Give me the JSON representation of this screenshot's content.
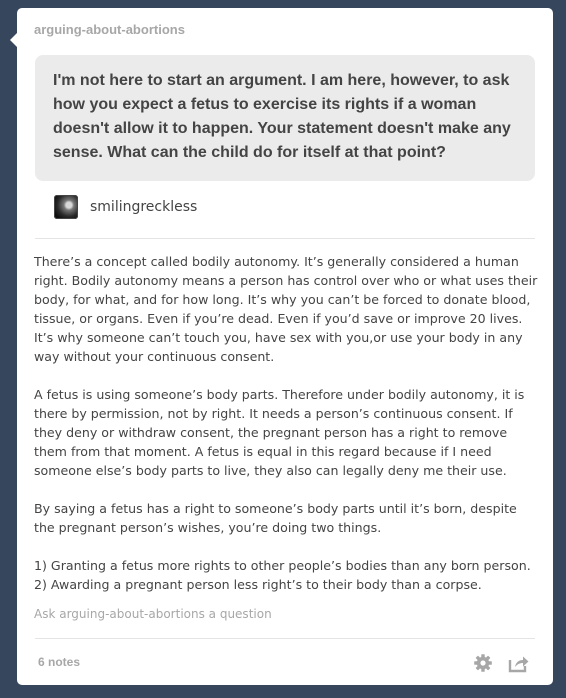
{
  "post": {
    "blog_name": "arguing-about-abortions",
    "question": "I'm not here to start an argument. I am here, however, to ask how you expect a fetus to exercise its rights if a woman doesn't allow it to happen. Your statement doesn't make any sense. What can the child do for itself at that point?",
    "asker": {
      "name": "smilingreckless",
      "avatar_icon": "avatar-image"
    },
    "answer": {
      "paragraphs": [
        "There’s a concept called bodily autonomy. It’s generally considered a human right. Bodily autonomy means a person has control over who or what uses their body, for what, and for how long. It’s why you can’t be forced to donate blood, tissue, or organs. Even if you’re dead. Even if you’d save or improve 20 lives. It’s why someone can’t touch you, have sex with you,or use your body in any way without your continuous consent.",
        "A fetus is using someone’s body parts. Therefore under bodily autonomy, it is there by permission, not by right. It needs a person’s continuous consent. If they deny or withdraw consent, the pregnant person has a right to remove them from that moment. A fetus is equal in this regard because if I need someone else’s body parts to live, they also can legally deny me their use.",
        "By saying a fetus has a right to someone’s body parts until it’s born, despite the pregnant person’s wishes, you’re doing two things."
      ],
      "list_items": [
        "1) Granting a fetus more rights to other people’s bodies than any born person.",
        "2) Awarding a pregnant person less right’s to their body than a corpse."
      ]
    },
    "ask_link": "Ask arguing-about-abortions a question",
    "notes": "6 notes",
    "icons": {
      "settings": "gear-icon",
      "share": "share-icon"
    },
    "colors": {
      "background": "#36465d",
      "card": "#ffffff",
      "bubble": "#ebebeb",
      "muted_text": "#a7a7a7",
      "body_text": "#444444"
    }
  }
}
